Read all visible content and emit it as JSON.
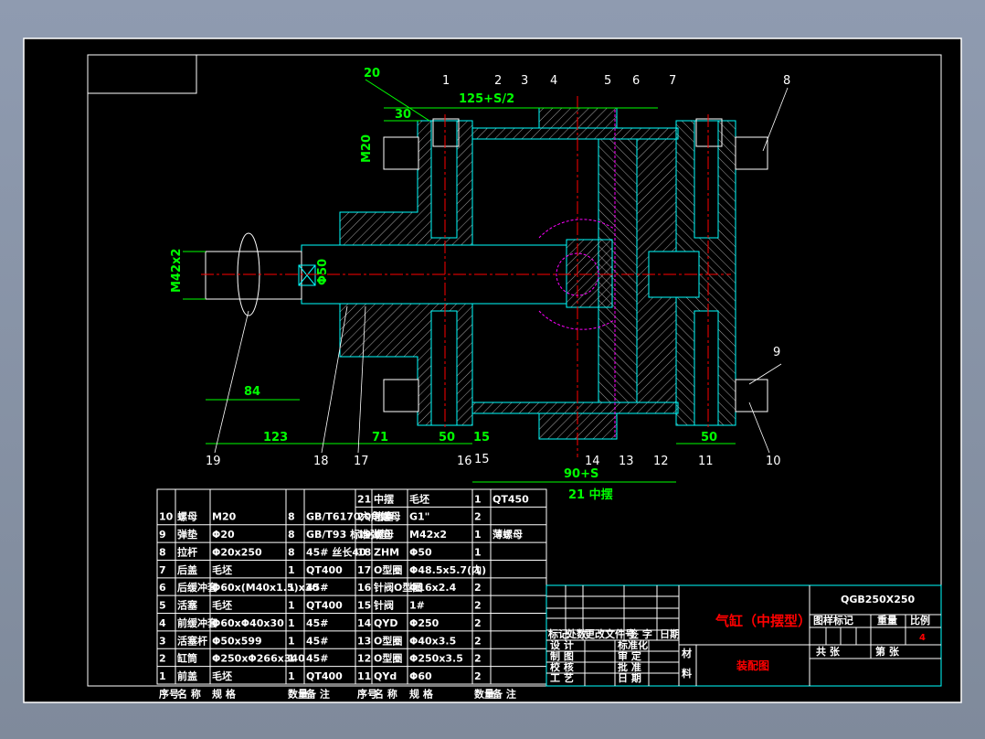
{
  "drawing": {
    "part_callouts": [
      "1",
      "2",
      "3",
      "4",
      "5",
      "6",
      "7",
      "8",
      "9",
      "10",
      "11",
      "12",
      "13",
      "14",
      "15",
      "16",
      "17",
      "18",
      "19",
      "20"
    ],
    "callout_15b": "15",
    "dimensions": {
      "d20": "20",
      "d30": "30",
      "d125": "125+S/2",
      "m20": "M20",
      "m42": "M42x2",
      "phi50": "Φ50",
      "d84": "84",
      "d123": "123",
      "d71": "71",
      "d50a": "50",
      "d15": "15",
      "d90": "90+S",
      "d50b": "50"
    },
    "trunnion_label": "21  中摆"
  },
  "parts_table": {
    "header": [
      "序号",
      "名 称",
      "规 格",
      "数量",
      "备 注",
      "序号",
      "名 称",
      "规 格",
      "数量",
      "备 注"
    ],
    "rows": [
      [
        "",
        "",
        "",
        "",
        "",
        "21",
        "中摆",
        "毛坯",
        "1",
        "QT450"
      ],
      [
        "10",
        "螺母",
        "M20",
        "8",
        "GB/T6170六角螺母",
        "20",
        "堵塞",
        "G1\"",
        "2",
        ""
      ],
      [
        "9",
        "弹垫",
        "Φ20",
        "8",
        "GB/T93 标准弹垫",
        "19",
        "螺母",
        "M42x2",
        "1",
        "薄螺母"
      ],
      [
        "8",
        "拉杆",
        "Φ20x250",
        "8",
        "45# 丝长40",
        "18",
        "ZHM",
        "Φ50",
        "1",
        ""
      ],
      [
        "7",
        "后盖",
        "毛坯",
        "1",
        "QT400",
        "17",
        "O型圈",
        "Φ48.5x5.7(内)",
        "1",
        ""
      ],
      [
        "6",
        "后缓冲套",
        "Φ60x(M40x1.5)x30",
        "1",
        "45#",
        "16",
        "针阀O型圈",
        "Φ16x2.4",
        "2",
        ""
      ],
      [
        "5",
        "活塞",
        "毛坯",
        "1",
        "QT400",
        "15",
        "针阀",
        "1#",
        "2",
        ""
      ],
      [
        "4",
        "前缓冲套",
        "Φ60xΦ40x30",
        "1",
        "45#",
        "14",
        "QYD",
        "Φ250",
        "2",
        ""
      ],
      [
        "3",
        "活塞杆",
        "Φ50x599",
        "1",
        "45#",
        "13",
        "O型圈",
        "Φ40x3.5",
        "2",
        ""
      ],
      [
        "2",
        "缸筒",
        "Φ250xΦ266x340",
        "1",
        "45#",
        "12",
        "O型圈",
        "Φ250x3.5",
        "2",
        ""
      ],
      [
        "1",
        "前盖",
        "毛坯",
        "1",
        "QT400",
        "11",
        "QYd",
        "Φ60",
        "2",
        ""
      ]
    ]
  },
  "title_block": {
    "revision_headers": [
      "标记",
      "处数",
      "更改文件号",
      "签 字",
      "日期"
    ],
    "signoff_left": [
      "设 计",
      "制 图",
      "校 核",
      "工 艺"
    ],
    "signoff_right": [
      "标准化",
      "审 定",
      "批 准",
      "日 期"
    ],
    "title": "气缸（中摆型）",
    "subtitle": "装配图",
    "material_label": [
      "材",
      "料"
    ],
    "drawing_number": "QGB250X250",
    "headers": [
      "图样标记",
      "重量",
      "比例"
    ],
    "scale": "4",
    "sheets_total": "共    张",
    "sheet_no": "第    张"
  },
  "colors": {
    "background": "#000000",
    "outline": "#00ffff",
    "dimension": "#00ff00",
    "centerline": "#ff0000",
    "phantom": "#ff00ff",
    "text": "#ffffff"
  }
}
